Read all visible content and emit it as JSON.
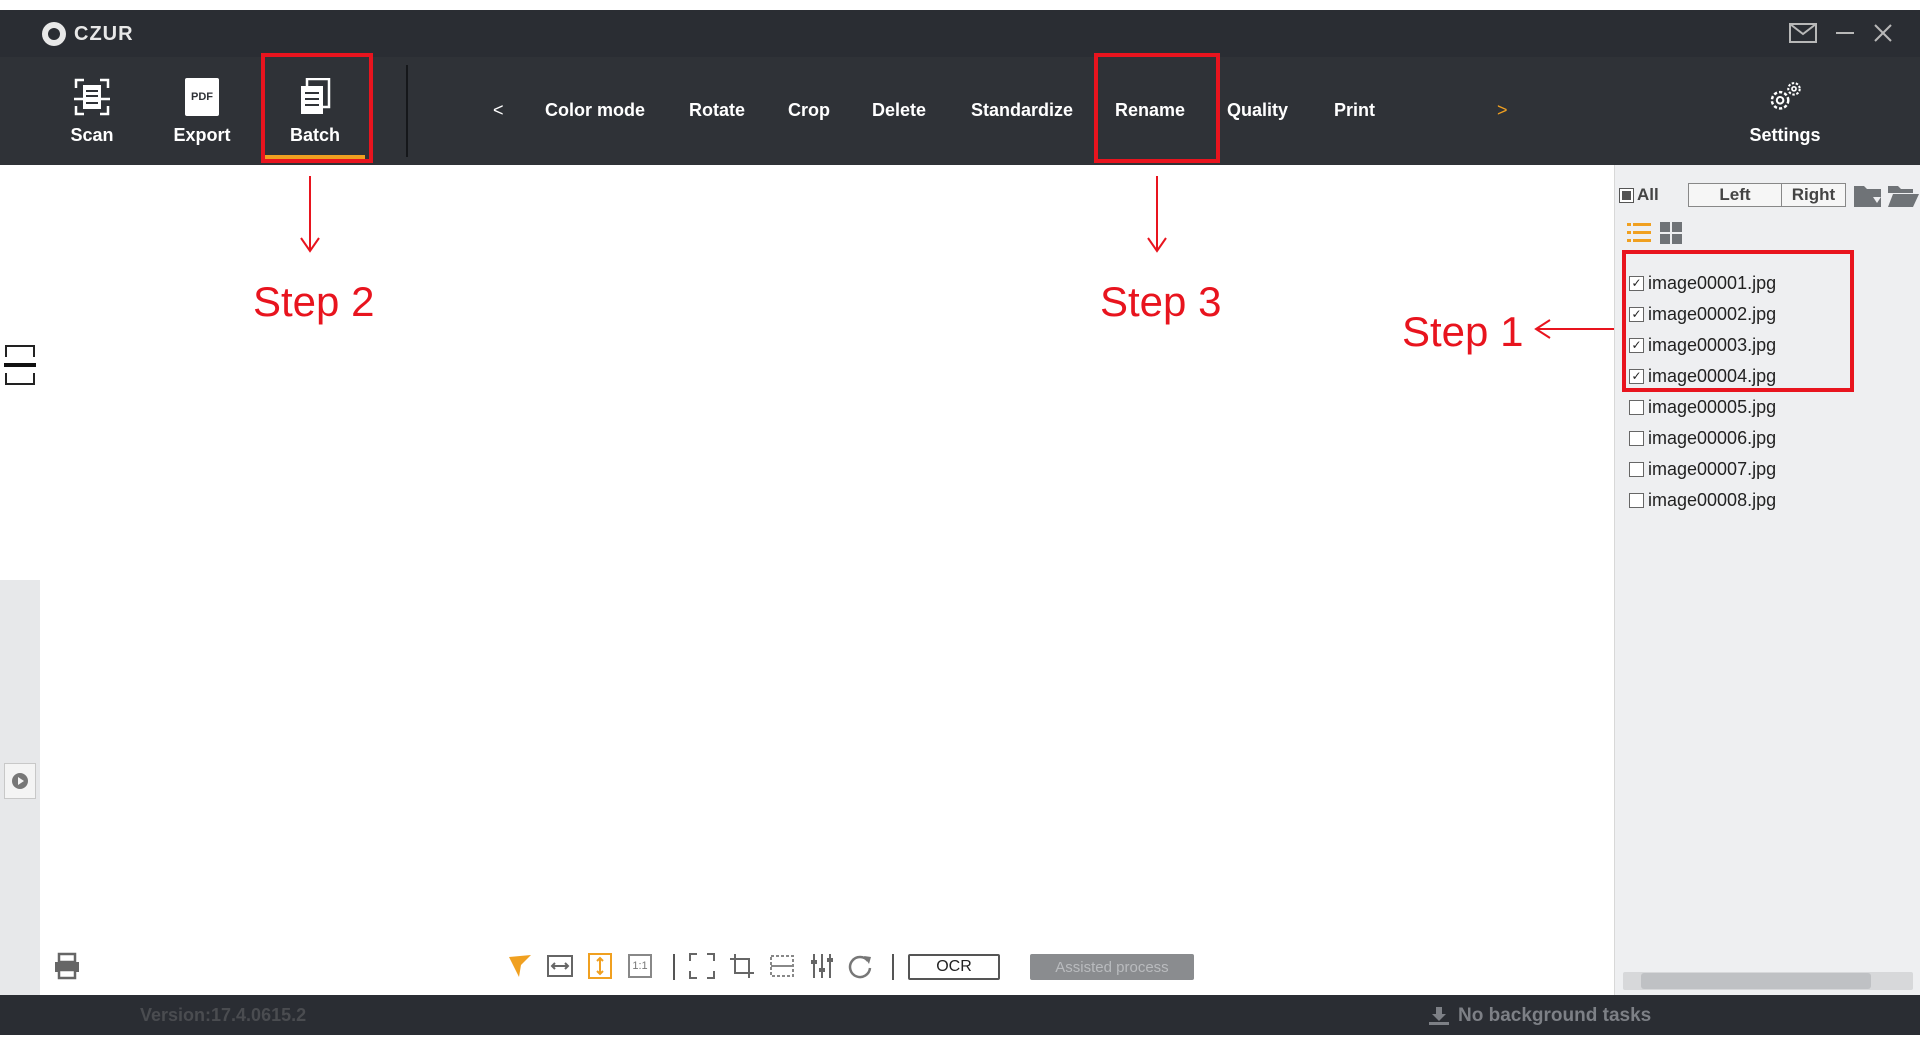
{
  "app": {
    "brand": "CZUR"
  },
  "toolbar": {
    "scan_label": "Scan",
    "export_label": "Export",
    "export_icon_text": "PDF",
    "batch_label": "Batch",
    "settings_label": "Settings",
    "prev_arrow": "<",
    "next_arrow": ">",
    "menu": [
      "Color mode",
      "Rotate",
      "Crop",
      "Delete",
      "Standardize",
      "Rename",
      "Quality",
      "Print"
    ]
  },
  "file_panel": {
    "all_label": "All",
    "left_label": "Left",
    "right_label": "Right",
    "files": [
      {
        "name": "image00001.jpg",
        "checked": true
      },
      {
        "name": "image00002.jpg",
        "checked": true
      },
      {
        "name": "image00003.jpg",
        "checked": true
      },
      {
        "name": "image00004.jpg",
        "checked": true
      },
      {
        "name": "image00005.jpg",
        "checked": false
      },
      {
        "name": "image00006.jpg",
        "checked": false
      },
      {
        "name": "image00007.jpg",
        "checked": false
      },
      {
        "name": "image00008.jpg",
        "checked": false
      }
    ]
  },
  "bottom_tools": {
    "ratio_label": "1:1",
    "ocr_label": "OCR",
    "assisted_label": "Assisted process"
  },
  "status": {
    "version": "Version:17.4.0615.2",
    "background_tasks": "No background tasks"
  },
  "annotations": {
    "step1": "Step 1",
    "step2": "Step 2",
    "step3": "Step 3",
    "color": "#e8141e"
  },
  "colors": {
    "accent": "#f0a020",
    "titlebar": "#2a2d33",
    "toolbar": "#2f3237"
  }
}
